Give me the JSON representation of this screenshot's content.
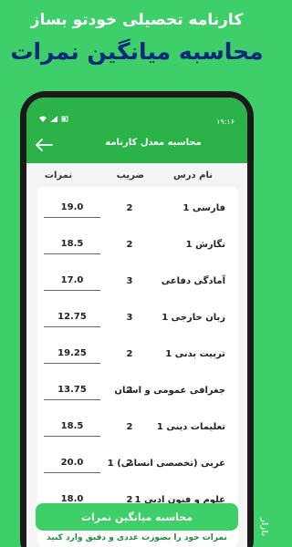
{
  "promo": {
    "line1": "کارنامه تحصیلی خودتو بساز",
    "line2": "محاسبه میانگین نمرات"
  },
  "status": {
    "time": "۱۹:۱۶"
  },
  "appbar": {
    "title": "محاسبه معدل کارنامه"
  },
  "columns": {
    "name": "نام درس",
    "factor": "ضریب",
    "score": "نمرات"
  },
  "rows": [
    {
      "name": "فارسی 1",
      "factor": "2",
      "score": "19.0"
    },
    {
      "name": "نگارش 1",
      "factor": "2",
      "score": "18.5"
    },
    {
      "name": "آمادگی دفاعی",
      "factor": "3",
      "score": "17.0"
    },
    {
      "name": "زبان خارجی 1",
      "factor": "3",
      "score": "12.75"
    },
    {
      "name": "تربیت بدنی 1",
      "factor": "2",
      "score": "19.25"
    },
    {
      "name": "جغرافی عمومی و استان",
      "factor": "2",
      "score": "13.75"
    },
    {
      "name": "تعلیمات دینی 1",
      "factor": "2",
      "score": "18.5"
    },
    {
      "name": "عربی (تخصصی انسانی) 1",
      "factor": "2",
      "score": "20.0"
    },
    {
      "name": "علوم و فنون ادبی 1",
      "factor": "2",
      "score": "18.0"
    }
  ],
  "calc_button": "محاسبه میانگین نمرات",
  "hint": "نمرات خود را بصورت عددی و دقیق وارد کنید",
  "watermark": "بازار",
  "colors": {
    "brand_green": "#3ecf6a",
    "appbar_green": "#2bb34a",
    "promo_blue": "#0b2a7a"
  }
}
